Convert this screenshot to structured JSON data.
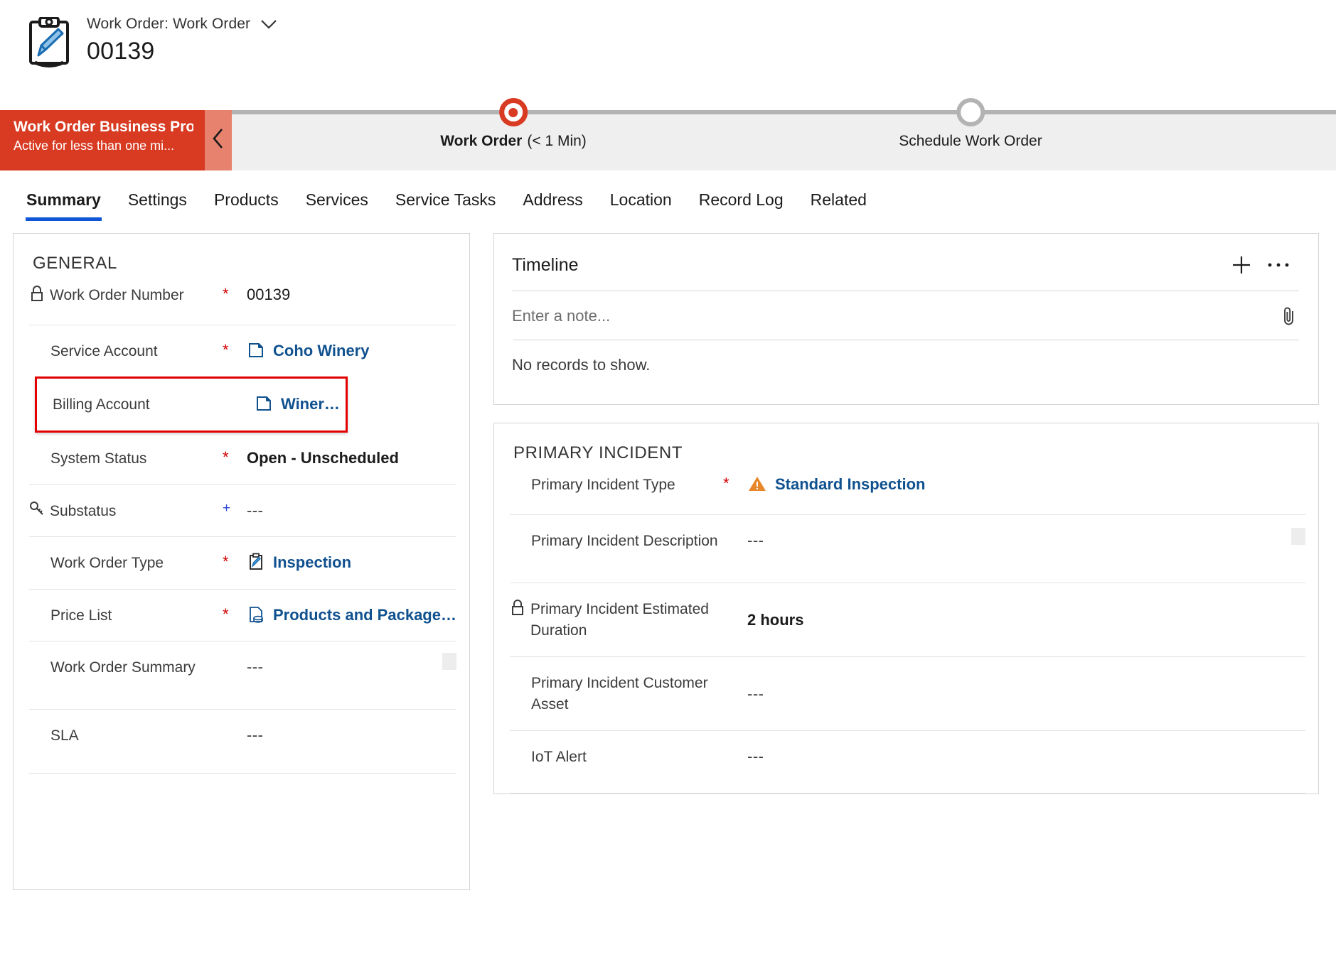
{
  "header": {
    "icon": "work-order-clipboard-icon",
    "entity_label": "Work Order: Work Order",
    "record_title": "00139",
    "dropdown_icon": "chevron-down-icon"
  },
  "business_process": {
    "name": "Work Order Business Pro...",
    "status": "Active for less than one mi...",
    "collapse_icon": "chevron-left-icon",
    "accent_color": "#d83b22",
    "stages": [
      {
        "name": "Work Order",
        "duration": "(< 1 Min)",
        "state": "active"
      },
      {
        "name": "Schedule Work Order",
        "duration": "",
        "state": "inactive"
      }
    ]
  },
  "tabs": [
    {
      "label": "Summary",
      "active": true
    },
    {
      "label": "Settings",
      "active": false
    },
    {
      "label": "Products",
      "active": false
    },
    {
      "label": "Services",
      "active": false
    },
    {
      "label": "Service Tasks",
      "active": false
    },
    {
      "label": "Address",
      "active": false
    },
    {
      "label": "Location",
      "active": false
    },
    {
      "label": "Record Log",
      "active": false
    },
    {
      "label": "Related",
      "active": false
    }
  ],
  "general": {
    "title": "GENERAL",
    "fields": {
      "work_order_number": {
        "label": "Work Order Number",
        "mark": "*",
        "value": "00139"
      },
      "service_account": {
        "label": "Service Account",
        "mark": "*",
        "value": "Coho Winery"
      },
      "billing_account": {
        "label": "Billing Account",
        "mark": "",
        "value": "Winery Inc."
      },
      "system_status": {
        "label": "System Status",
        "mark": "*",
        "value": "Open - Unscheduled"
      },
      "substatus": {
        "label": "Substatus",
        "mark": "+",
        "value": "---"
      },
      "work_order_type": {
        "label": "Work Order Type",
        "mark": "*",
        "value": "Inspection"
      },
      "price_list": {
        "label": "Price List",
        "mark": "*",
        "value": "Products and Packaged Se..."
      },
      "work_order_summary": {
        "label": "Work Order Summary",
        "mark": "",
        "value": "---"
      },
      "sla": {
        "label": "SLA",
        "mark": "",
        "value": "---"
      }
    }
  },
  "timeline": {
    "title": "Timeline",
    "add_icon": "plus-icon",
    "more_icon": "ellipsis-icon",
    "attach_icon": "paperclip-icon",
    "note_placeholder": "Enter a note...",
    "empty_text": "No records to show."
  },
  "primary_incident": {
    "title": "PRIMARY INCIDENT",
    "fields": {
      "type": {
        "label": "Primary Incident Type",
        "mark": "*",
        "value": "Standard Inspection"
      },
      "description": {
        "label": "Primary Incident Description",
        "mark": "",
        "value": "---"
      },
      "duration": {
        "label": "Primary Incident Estimated Duration",
        "mark": "",
        "value": "2 hours"
      },
      "asset": {
        "label": "Primary Incident Customer Asset",
        "mark": "",
        "value": "---"
      },
      "iot_alert": {
        "label": "IoT Alert",
        "mark": "",
        "value": "---"
      }
    }
  },
  "colors": {
    "link": "#10518f",
    "required": "#d00000",
    "optional": "#2b44d6",
    "highlight": "#e30000",
    "tab_underline": "#0f56d6",
    "warning": "#e8862a"
  }
}
